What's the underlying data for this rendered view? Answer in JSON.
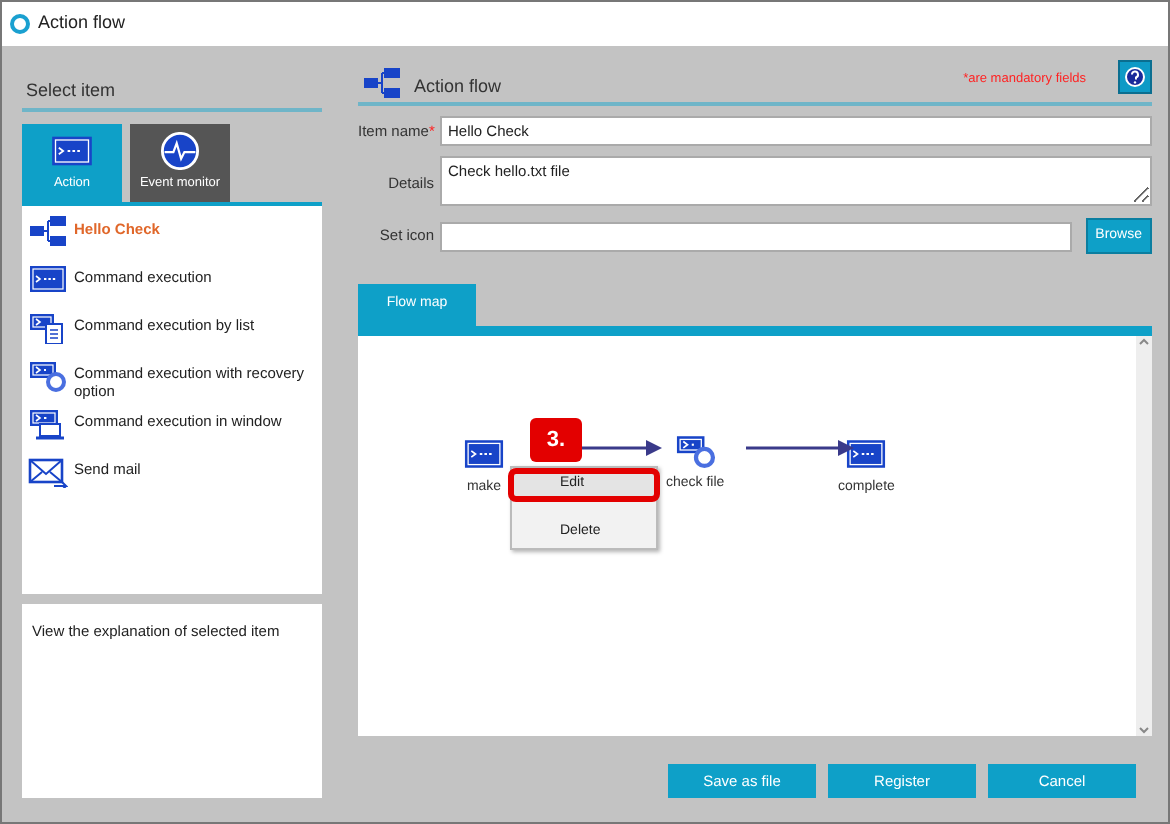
{
  "window": {
    "title": "Action flow"
  },
  "left": {
    "heading": "Select item",
    "tabs": [
      {
        "label": "Action",
        "kind": "action",
        "selected": true
      },
      {
        "label": "Event monitor",
        "kind": "monitor",
        "selected": false
      }
    ],
    "items": [
      {
        "label": "Hello Check",
        "kind": "flow",
        "selected": true
      },
      {
        "label": "Command execution",
        "kind": "command",
        "selected": false
      },
      {
        "label": "Command execution by list",
        "kind": "list",
        "selected": false
      },
      {
        "label": "Command execution with recovery option",
        "kind": "recovery",
        "selected": false
      },
      {
        "label": "Command execution in window",
        "kind": "window",
        "selected": false
      },
      {
        "label": "Send mail",
        "kind": "mail",
        "selected": false
      }
    ],
    "explanation": "View the explanation of selected item"
  },
  "form": {
    "heading": "Action flow",
    "mandatory_note": "*are mandatory fields",
    "fields": [
      {
        "label": "Item name",
        "required_mark": "*",
        "kind": "line",
        "value": "Hello Check"
      },
      {
        "label": "Details",
        "kind": "area",
        "value": "Check hello.txt file"
      },
      {
        "label": "Set icon",
        "kind": "browse",
        "button": "Browse"
      }
    ]
  },
  "flow_tab": {
    "label": "Flow map",
    "selected": true
  },
  "flow": {
    "nodes": [
      {
        "label": "make",
        "kind": "command"
      },
      {
        "label": "check file",
        "kind": "recovery"
      },
      {
        "label": "complete",
        "kind": "command"
      }
    ],
    "menu": [
      {
        "label": "Edit",
        "highlighted": true
      },
      {
        "label": "Delete",
        "highlighted": false
      }
    ],
    "callout": "3."
  },
  "buttons": [
    "Save as file",
    "Register",
    "Cancel"
  ]
}
